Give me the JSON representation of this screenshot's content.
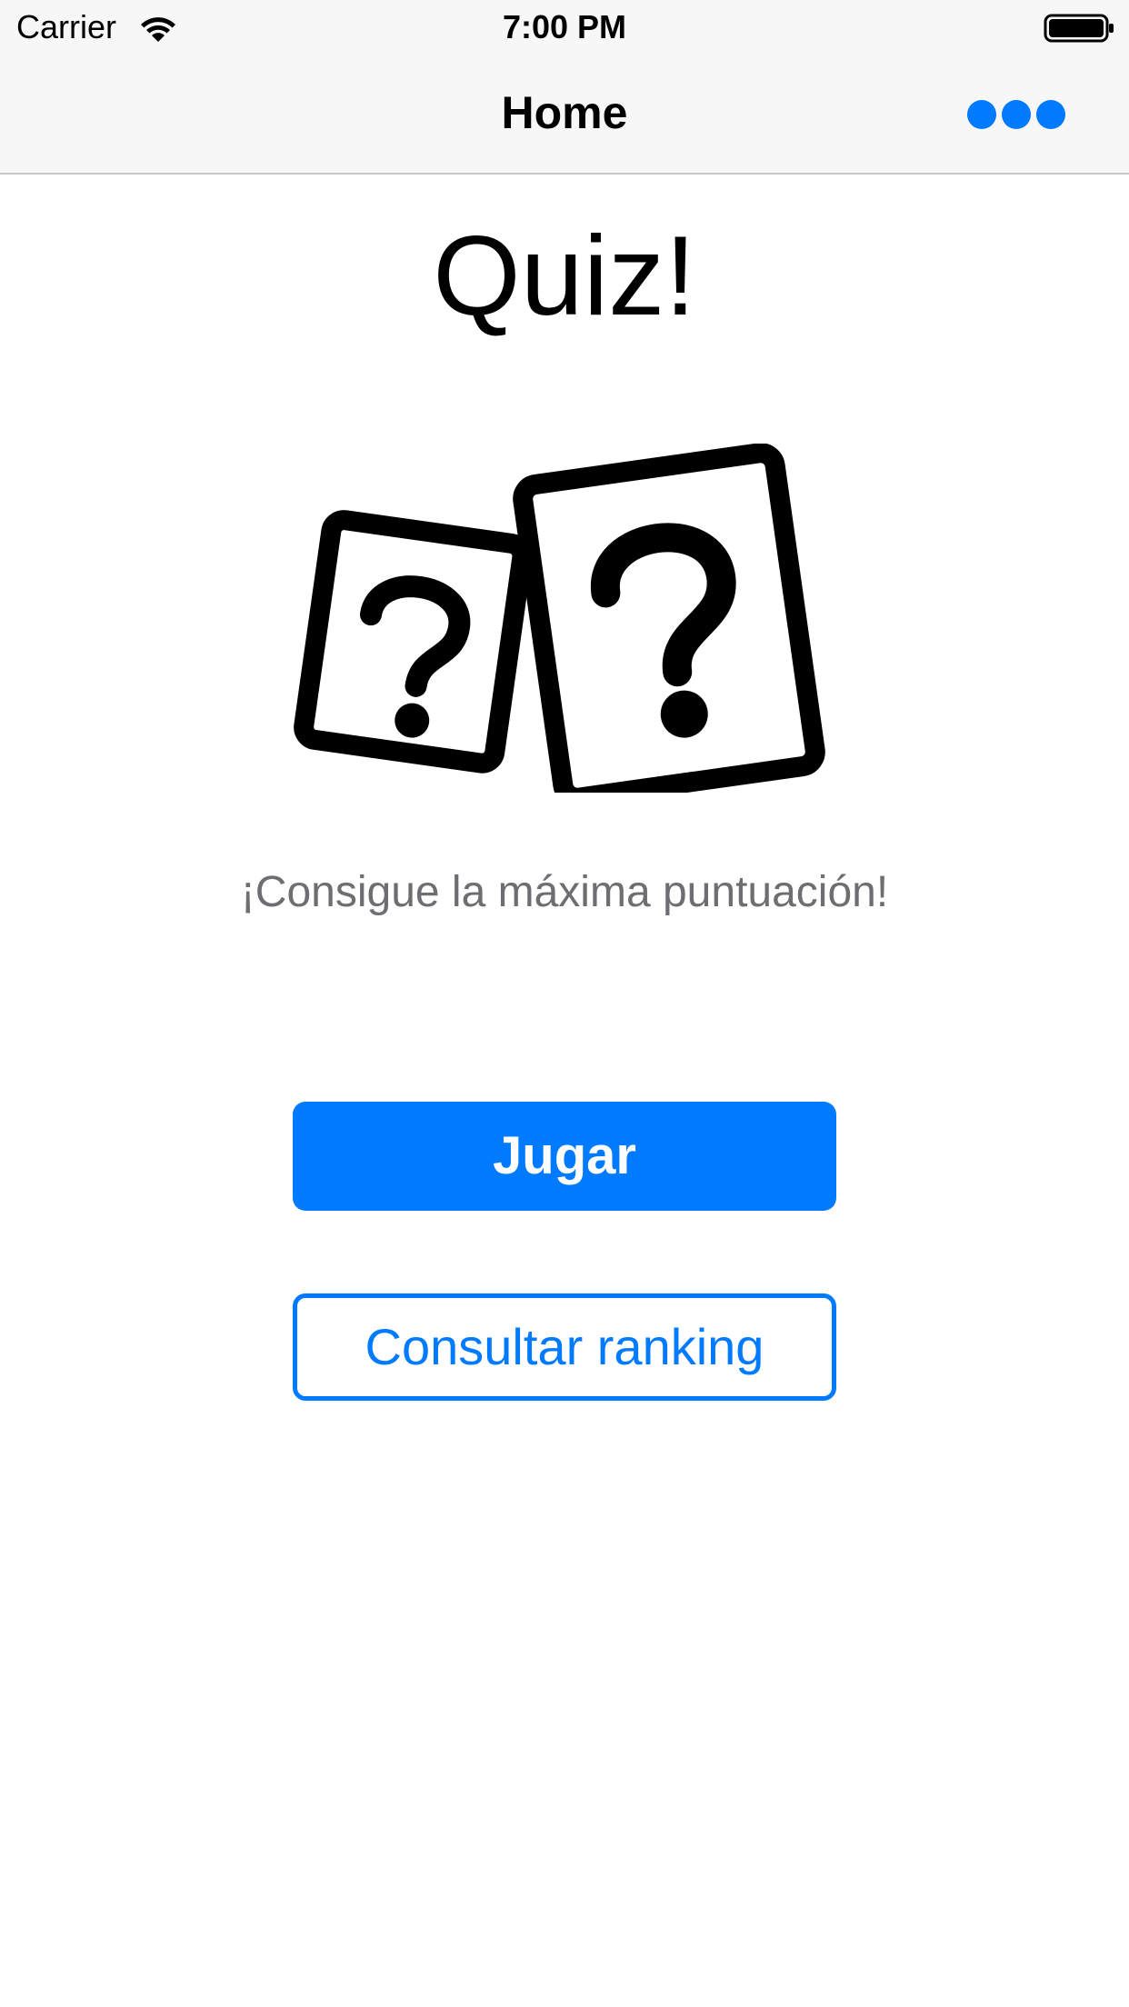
{
  "status_bar": {
    "carrier": "Carrier",
    "time": "7:00 PM",
    "icons": [
      "wifi-icon",
      "battery-icon"
    ]
  },
  "nav": {
    "title": "Home",
    "more_icon": "more-icon"
  },
  "main": {
    "title": "Quiz!",
    "hero_icon": "question-cards-icon",
    "subtitle": "¡Consigue la máxima puntuación!",
    "play_label": "Jugar",
    "ranking_label": "Consultar ranking"
  },
  "colors": {
    "accent": "#007aff",
    "bar_background": "#f7f7f7",
    "subtitle": "#6d6d72"
  }
}
